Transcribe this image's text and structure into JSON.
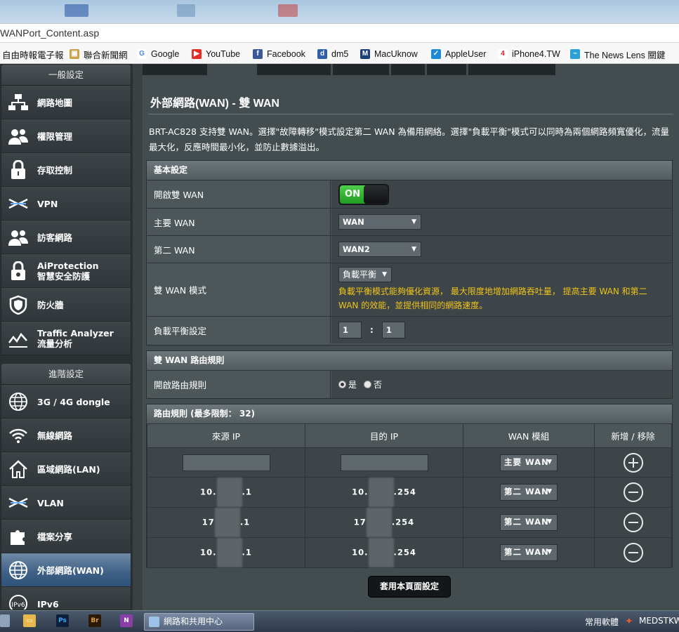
{
  "browser": {
    "url": "WANPort_Content.asp",
    "bookmarks": [
      {
        "label": "自由時報電子報",
        "icon": "news-icon"
      },
      {
        "label": "聯合新聞網",
        "icon": "udn-icon"
      },
      {
        "label": "Google",
        "icon": "google-icon"
      },
      {
        "label": "YouTube",
        "icon": "youtube-icon"
      },
      {
        "label": "Facebook",
        "icon": "facebook-icon"
      },
      {
        "label": "dm5",
        "icon": "dm5-icon"
      },
      {
        "label": "MacUknow",
        "icon": "macuknow-icon"
      },
      {
        "label": "AppleUser",
        "icon": "appleuser-icon"
      },
      {
        "label": "iPhone4.TW",
        "icon": "iphone4tw-icon"
      },
      {
        "label": "The News Lens 關鍵",
        "icon": "newslens-icon"
      }
    ]
  },
  "sidebar": {
    "general_header": "一般設定",
    "general_items": [
      {
        "label": "網路地圖",
        "icon": "network-map-icon"
      },
      {
        "label": "權限管理",
        "icon": "users-icon"
      },
      {
        "label": "存取控制",
        "icon": "lock-icon"
      },
      {
        "label": "VPN",
        "icon": "vpn-icon"
      },
      {
        "label": "訪客網路",
        "icon": "guest-icon"
      },
      {
        "label": "AiProtection",
        "label2": "智慧安全防護",
        "icon": "aiprotection-icon"
      },
      {
        "label": "防火牆",
        "icon": "shield-icon"
      },
      {
        "label": "Traffic Analyzer",
        "label2": "流量分析",
        "icon": "traffic-icon"
      }
    ],
    "advanced_header": "進階設定",
    "advanced_items": [
      {
        "label": "3G / 4G dongle",
        "icon": "globe-icon"
      },
      {
        "label": "無線網路",
        "icon": "wifi-icon"
      },
      {
        "label": "區域網路(LAN)",
        "icon": "home-icon"
      },
      {
        "label": "VLAN",
        "icon": "vlan-icon"
      },
      {
        "label": "檔案分享",
        "icon": "puzzle-icon"
      },
      {
        "label": "外部網路(WAN)",
        "icon": "globe-icon",
        "active": true
      },
      {
        "label": "IPv6",
        "icon": "ipv6-icon"
      }
    ]
  },
  "main": {
    "title": "外部網路(WAN) - 雙 WAN",
    "description": "BRT-AC828 支持雙 WAN。選擇\"故障轉移\"模式設定第二 WAN 為備用網絡。選擇\"負載平衡\"模式可以同時為兩個網路頻寬優化，流量最大化，反應時間最小化，並防止數據溢出。",
    "basic": {
      "header": "基本設定",
      "enable_label": "開啟雙 WAN",
      "enable_value": "ON",
      "primary_label": "主要 WAN",
      "primary_value": "WAN",
      "secondary_label": "第二 WAN",
      "secondary_value": "WAN2",
      "mode_label": "雙 WAN 模式",
      "mode_value": "負載平衡",
      "mode_note": "負載平衡模式能夠優化資源， 最大限度地增加網路吞吐量， 提高主要 WAN 和第二 WAN 的效能，並提供相同的網路速度。",
      "ratio_label": "負載平衡設定",
      "ratio_a": "1",
      "ratio_sep": ":",
      "ratio_b": "1"
    },
    "routing": {
      "header": "雙 WAN 路由規則",
      "enable_label": "開啟路由規則",
      "yes": "是",
      "no": "否"
    },
    "rules": {
      "header": "路由規則 (最多限制： 32)",
      "columns": [
        "來源 IP",
        "目的 IP",
        "WAN 模組",
        "新增 / 移除"
      ],
      "new_wan": "主要 WAN",
      "rows": [
        {
          "src_a": "10.",
          "src_b": ".1",
          "dst_a": "10.",
          "dst_b": ".254",
          "wan": "第二 WAN"
        },
        {
          "src_a": "17",
          "src_b": ".1",
          "dst_a": "17",
          "dst_b": ".254",
          "wan": "第二 WAN"
        },
        {
          "src_a": "10.",
          "src_b": ".1",
          "dst_a": "10.",
          "dst_b": ".254",
          "wan": "第二 WAN"
        }
      ]
    },
    "apply_label": "套用本頁面設定"
  },
  "taskbar": {
    "task_label": "網路和共用中心",
    "tray1": "常用軟體",
    "tray2": "MEDSTKW",
    "apps": [
      "explorer",
      "Ps",
      "Br",
      "N"
    ]
  },
  "colors": {
    "accent_on": "#2aa82a",
    "note": "#f0c419",
    "active_nav": "#3e6086"
  }
}
